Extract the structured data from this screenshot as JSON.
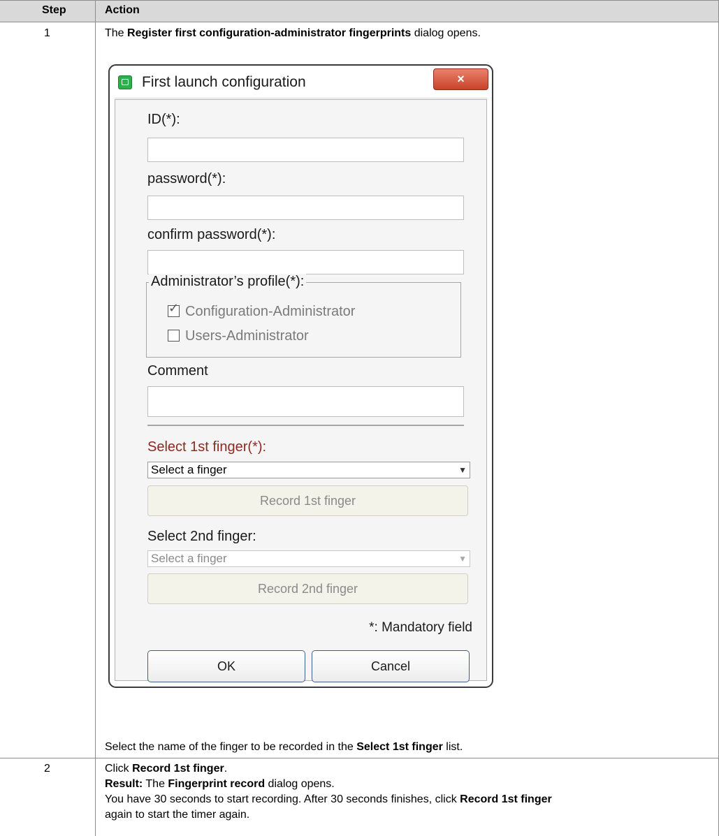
{
  "table": {
    "headers": {
      "step": "Step",
      "action": "Action"
    },
    "row1": {
      "step": "1",
      "intro_pre": "The ",
      "intro_bold": "Register first configuration-administrator fingerprints",
      "intro_post": " dialog opens.",
      "outro_pre": "Select the name of the finger to be recorded in the ",
      "outro_bold": "Select 1st finger",
      "outro_post": " list."
    },
    "row2": {
      "step": "2",
      "line1_pre": "Click ",
      "line1_bold": "Record 1st finger",
      "line1_post": ".",
      "line2_bold": "Result:",
      "line2_mid": " The ",
      "line2_bold2": "Fingerprint record",
      "line2_post": " dialog opens.",
      "line3_pre": "You have 30 seconds to start recording. After 30 seconds finishes, click ",
      "line3_bold": "Record 1st finger",
      "line4": "again to start the timer again."
    }
  },
  "dialog": {
    "title": "First launch configuration",
    "close_glyph": "×",
    "icon": "app-icon",
    "id_label": "ID(*):",
    "id_value": "",
    "password_label": "password(*):",
    "password_value": "",
    "confirm_label": "confirm password(*):",
    "confirm_value": "",
    "profile_legend": "Administrator’s profile(*):",
    "profile_options": [
      {
        "label": "Configuration-Administrator",
        "checked": true
      },
      {
        "label": "Users-Administrator",
        "checked": false
      }
    ],
    "comment_label": "Comment",
    "comment_value": "",
    "finger1_label": "Select 1st finger(*):",
    "finger1_label_color": "#8b2a22",
    "finger1_selected": "Select a finger",
    "record1_label": "Record 1st finger",
    "finger2_label": "Select 2nd finger:",
    "finger2_selected": "Select a finger",
    "record2_label": "Record 2nd finger",
    "mandatory_note": "*: Mandatory field",
    "ok_label": "OK",
    "cancel_label": "Cancel"
  }
}
